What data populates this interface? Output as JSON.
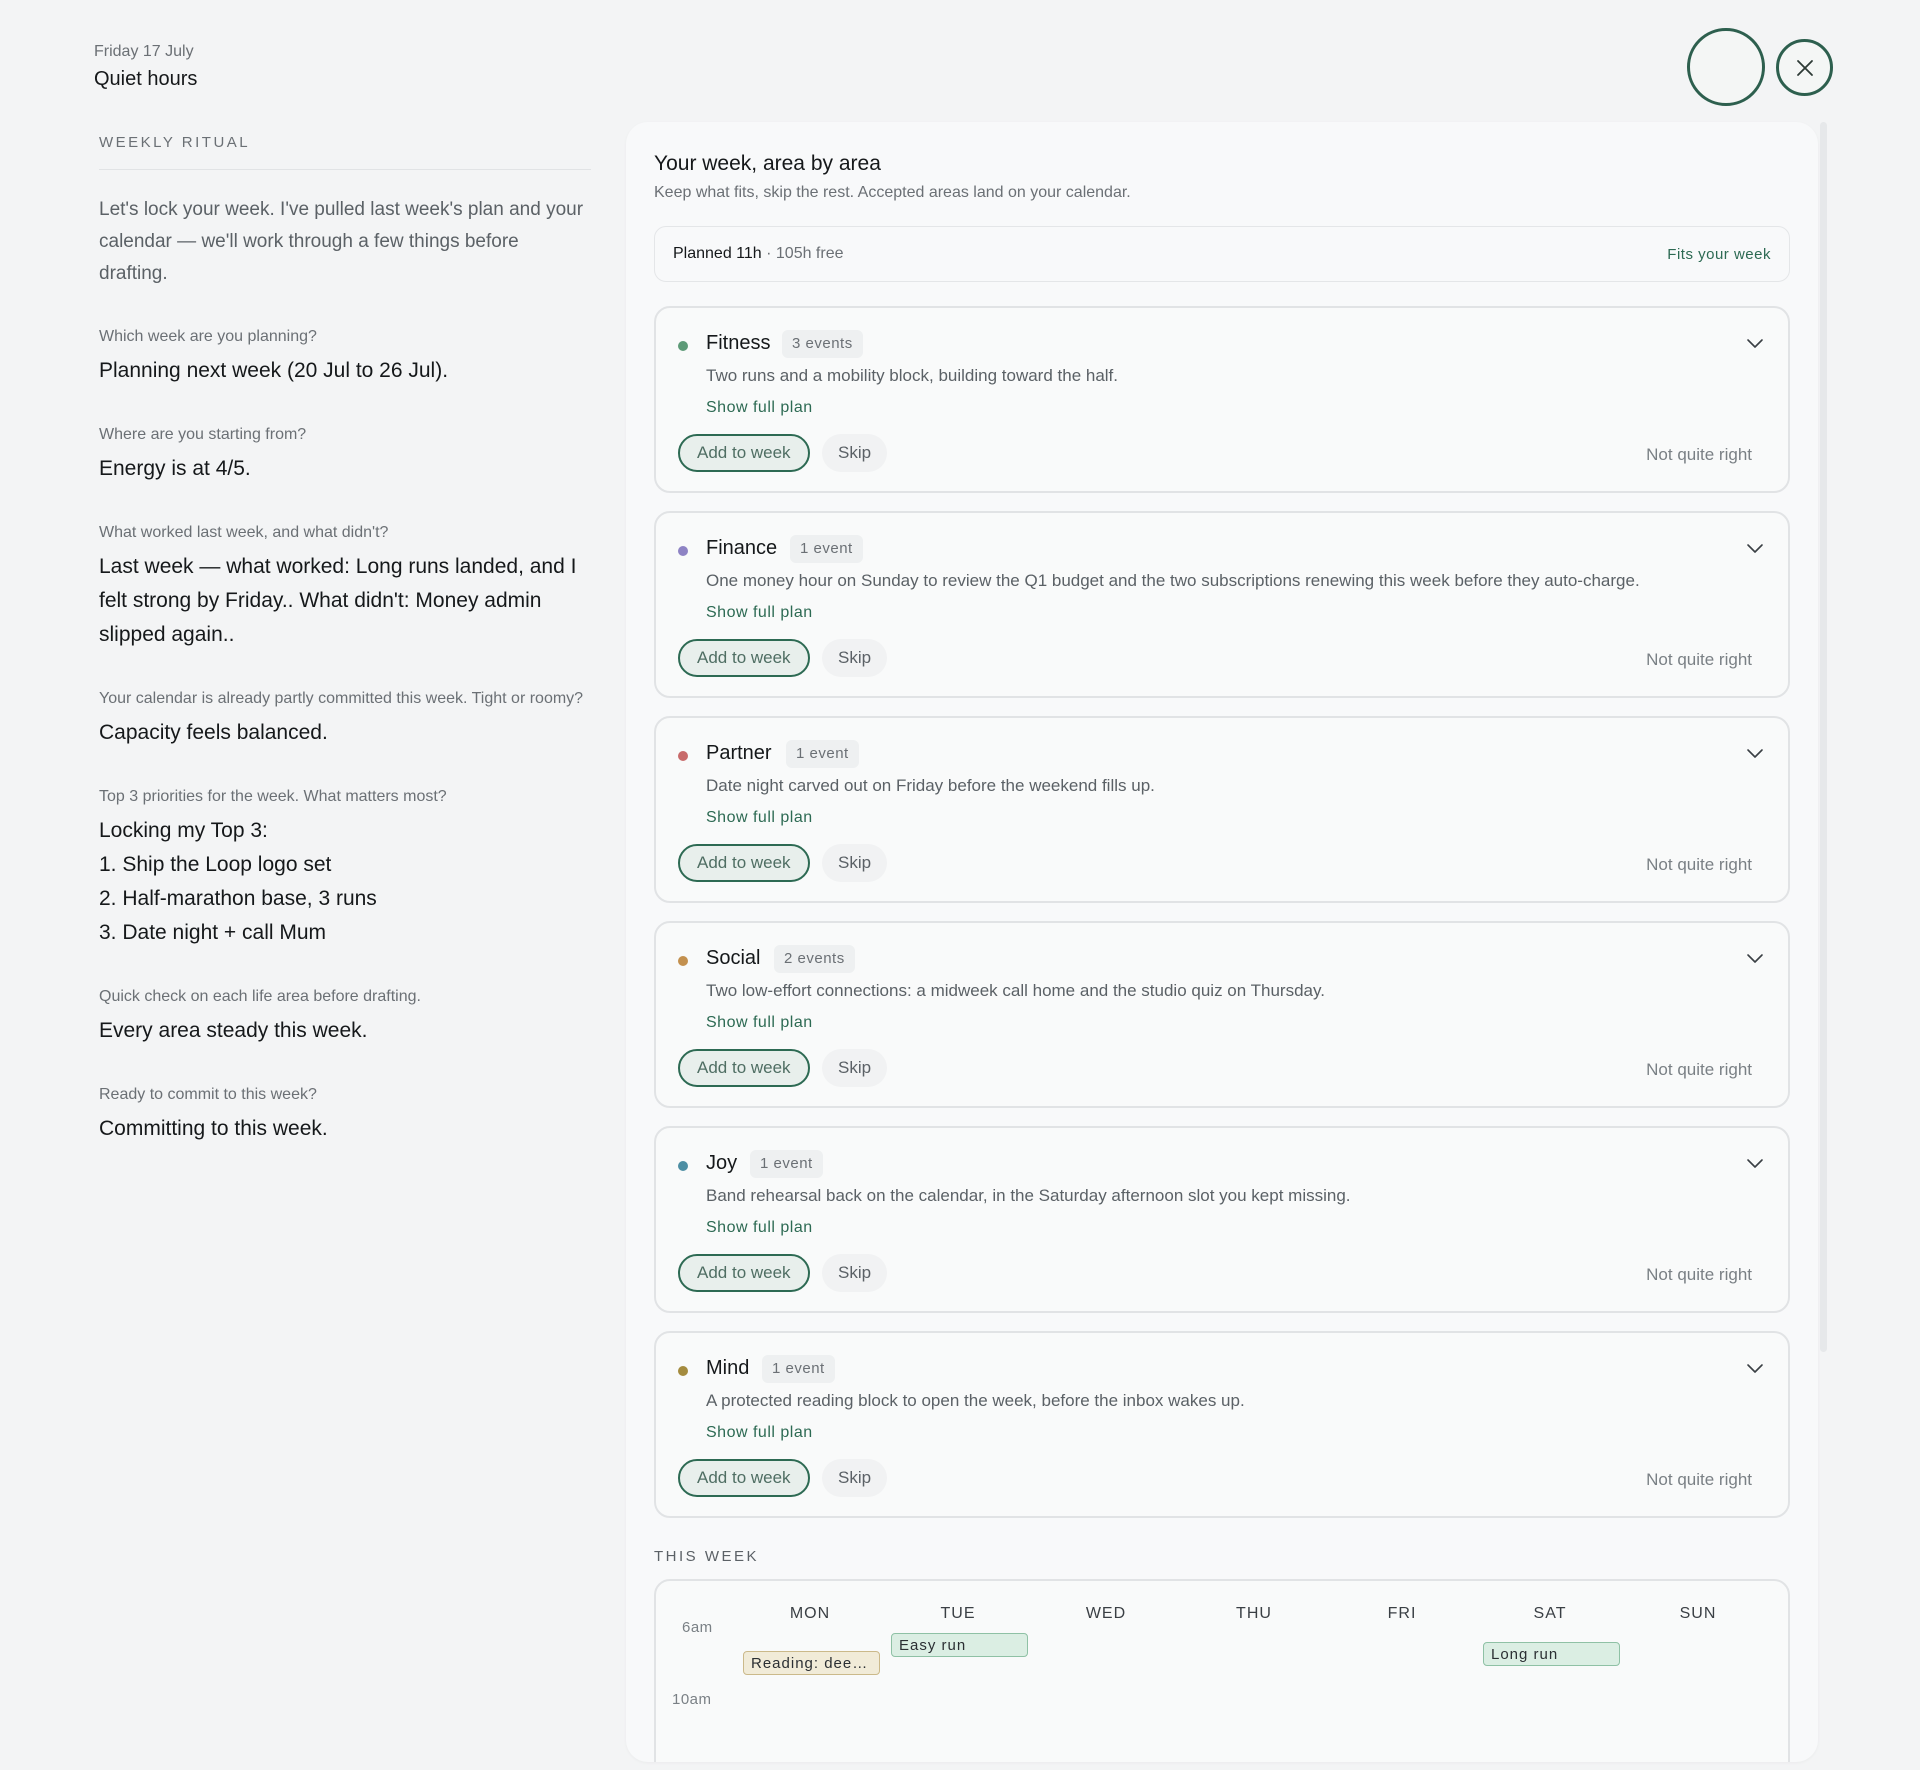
{
  "header": {
    "date": "Friday 17 July",
    "title": "Quiet hours"
  },
  "left": {
    "section_label": "WEEKLY RITUAL",
    "intro": "Let's lock your week. I've pulled last week's plan and your calendar — we'll work through a few things before drafting.",
    "qa": [
      {
        "q": "Which week are you planning?",
        "a": "Planning next week (20 Jul to 26 Jul)."
      },
      {
        "q": "Where are you starting from?",
        "a": "Energy is at 4/5."
      },
      {
        "q": "What worked last week, and what didn't?",
        "a": "Last week — what worked: Long runs landed, and I felt strong by Friday.. What didn't: Money admin slipped again.."
      },
      {
        "q": "Your calendar is already partly committed this week. Tight or roomy?",
        "a": "Capacity feels balanced."
      },
      {
        "q": "Top 3 priorities for the week. What matters most?",
        "a": "Locking my Top 3:\n1. Ship the Loop logo set\n2. Half-marathon base, 3 runs\n3. Date night + call Mum"
      },
      {
        "q": "Quick check on each life area before drafting.",
        "a": "Every area steady this week."
      },
      {
        "q": "Ready to commit to this week?",
        "a": "Committing to this week."
      }
    ]
  },
  "panel": {
    "title": "Your week, area by area",
    "subtitle": "Keep what fits, skip the rest. Accepted areas land on your calendar.",
    "summary": {
      "planned": "Planned 11h",
      "free": " · 105h free",
      "status": "Fits your week"
    },
    "cards": [
      {
        "name": "Fitness",
        "count": "3 events",
        "color": "#5d9a77",
        "desc": "Two runs and a mobility block, building toward the half.",
        "show": "Show full plan",
        "add": "Add to week",
        "skip": "Skip",
        "nqr": "Not quite right"
      },
      {
        "name": "Finance",
        "count": "1 event",
        "color": "#8e83c4",
        "desc": "One money hour on Sunday to review the Q1 budget and the two subscriptions renewing this week before they auto-charge.",
        "show": "Show full plan",
        "add": "Add to week",
        "skip": "Skip",
        "nqr": "Not quite right"
      },
      {
        "name": "Partner",
        "count": "1 event",
        "color": "#c86a6a",
        "desc": "Date night carved out on Friday before the weekend fills up.",
        "show": "Show full plan",
        "add": "Add to week",
        "skip": "Skip",
        "nqr": "Not quite right"
      },
      {
        "name": "Social",
        "count": "2 events",
        "color": "#c3904e",
        "desc": "Two low-effort connections: a midweek call home and the studio quiz on Thursday.",
        "show": "Show full plan",
        "add": "Add to week",
        "skip": "Skip",
        "nqr": "Not quite right"
      },
      {
        "name": "Joy",
        "count": "1 event",
        "color": "#4d8ea3",
        "desc": "Band rehearsal back on the calendar, in the Saturday afternoon slot you kept missing.",
        "show": "Show full plan",
        "add": "Add to week",
        "skip": "Skip",
        "nqr": "Not quite right"
      },
      {
        "name": "Mind",
        "count": "1 event",
        "color": "#a48b3e",
        "desc": "A protected reading block to open the week, before the inbox wakes up.",
        "show": "Show full plan",
        "add": "Add to week",
        "skip": "Skip",
        "nqr": "Not quite right"
      }
    ],
    "week": {
      "label": "THIS WEEK",
      "days": [
        "MON",
        "TUE",
        "WED",
        "THU",
        "FRI",
        "SAT",
        "SUN"
      ],
      "times": [
        "6am",
        "10am"
      ],
      "events": [
        {
          "day": "MON",
          "label": "Reading: dee…",
          "style": "yellow"
        },
        {
          "day": "TUE",
          "label": "Easy run",
          "style": "green"
        },
        {
          "day": "SAT",
          "label": "Long run",
          "style": "green"
        }
      ]
    }
  }
}
